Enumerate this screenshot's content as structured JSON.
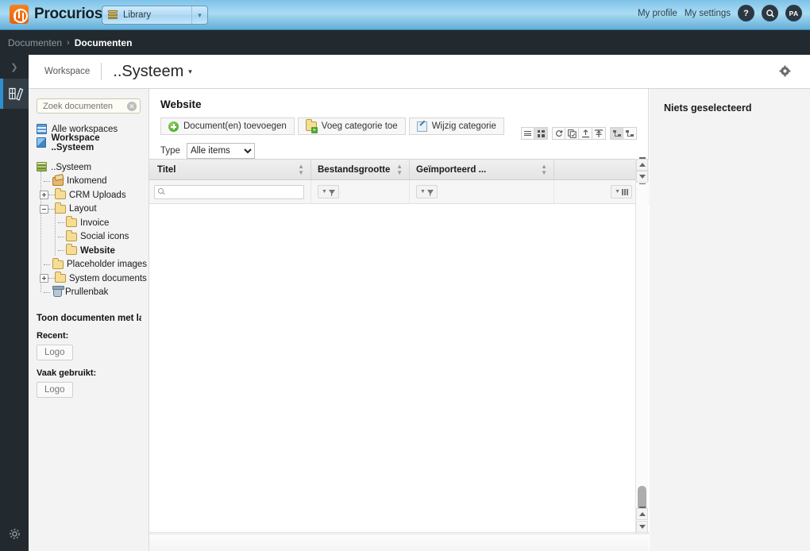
{
  "topbar": {
    "brand": "Procurios",
    "brand_color": "#f58220",
    "library_selector": {
      "label": "Library",
      "icon": "books-stack-icon"
    },
    "nav": [
      {
        "label": "My profile",
        "name": "my-profile-link"
      },
      {
        "label": "My settings",
        "name": "my-settings-link"
      }
    ],
    "help_button": "?",
    "search_button": "search-icon",
    "avatar_initials": "PA"
  },
  "breadcrumb": {
    "parent": "Documenten",
    "separator": "›",
    "current": "Documenten"
  },
  "rail": {
    "expand_icon": "chevron-right-icon",
    "active_item": "library-books-icon",
    "settings_icon": "gear-icon"
  },
  "workspace_header": {
    "tag": "Workspace",
    "title": "..Systeem",
    "caret": "▾",
    "settings_icon": "gear-icon"
  },
  "sidebar": {
    "search": {
      "value": "",
      "placeholder": "Zoek documenten",
      "clear_icon": "clear-circle-icon"
    },
    "workspaces": [
      {
        "label": "Alle workspaces",
        "icon": "all-workspaces-icon",
        "active": false
      },
      {
        "label": "Workspace ..Systeem",
        "icon": "workspace-icon",
        "active": true
      }
    ],
    "tree": [
      {
        "label": "..Systeem",
        "icon": "stack-icon",
        "level": 0,
        "toggle": "none",
        "bold": false
      },
      {
        "label": "Inkomend",
        "icon": "inbox-icon",
        "level": 1,
        "toggle": "none",
        "bold": false
      },
      {
        "label": "CRM Uploads",
        "icon": "folder-icon",
        "level": 1,
        "toggle": "plus",
        "bold": false
      },
      {
        "label": "Layout",
        "icon": "folder-icon",
        "level": 1,
        "toggle": "minus",
        "bold": false
      },
      {
        "label": "Invoice",
        "icon": "folder-icon",
        "level": 2,
        "toggle": "none",
        "bold": false
      },
      {
        "label": "Social icons",
        "icon": "folder-icon",
        "level": 2,
        "toggle": "none",
        "bold": false
      },
      {
        "label": "Website",
        "icon": "folder-icon",
        "level": 2,
        "toggle": "none",
        "bold": true
      },
      {
        "label": "Placeholder images",
        "icon": "folder-icon",
        "level": 1,
        "toggle": "none",
        "bold": false
      },
      {
        "label": "System documents",
        "icon": "folder-icon",
        "level": 1,
        "toggle": "plus",
        "bold": false
      },
      {
        "label": "Prullenbak",
        "icon": "trash-icon",
        "level": 1,
        "toggle": "none",
        "bold": false
      }
    ],
    "doc_filter": {
      "title": "Toon documenten met la",
      "recent_label": "Recent:",
      "recent_chip": "Logo",
      "frequent_label": "Vaak gebruikt:",
      "frequent_chip": "Logo"
    }
  },
  "main": {
    "title": "Website",
    "buttons": [
      {
        "label": "Document(en) toevoegen",
        "icon": "add-circle-icon",
        "name": "add-documents-button"
      },
      {
        "label": "Voeg categorie toe",
        "icon": "folder-add-icon",
        "name": "add-category-button"
      },
      {
        "label": "Wijzig categorie",
        "icon": "edit-category-icon",
        "name": "edit-category-button"
      }
    ],
    "type_filter": {
      "label": "Type",
      "selected": "Alle items",
      "options": [
        "Alle items"
      ]
    },
    "view_buttons": [
      {
        "icon": "list-view-icon",
        "active": false,
        "name": "list-view-button"
      },
      {
        "icon": "grid-view-icon",
        "active": true,
        "name": "grid-view-button"
      },
      {
        "icon": "refresh-icon",
        "active": false,
        "name": "refresh-button"
      },
      {
        "icon": "copy-icon",
        "active": false,
        "name": "copy-button"
      },
      {
        "icon": "upload-icon",
        "active": false,
        "name": "upload-button"
      },
      {
        "icon": "fit-width-icon",
        "active": false,
        "name": "fit-width-button"
      },
      {
        "icon": "tree-panel-left-icon",
        "active": true,
        "name": "tree-left-button"
      },
      {
        "icon": "tree-panel-right-icon",
        "active": false,
        "name": "tree-right-button"
      }
    ],
    "table": {
      "columns": [
        {
          "label": "Titel",
          "sortable": true,
          "name": "column-titel"
        },
        {
          "label": "Bestandsgrootte",
          "sortable": true,
          "name": "column-bestandsgrootte"
        },
        {
          "label": "Geïmporteerd ...",
          "sortable": true,
          "name": "column-geimporteerd"
        },
        {
          "label": "",
          "sortable": false,
          "name": "column-spacer"
        }
      ],
      "filter_row": {
        "titel_search_value": "",
        "titel_search_icon": "search-icon",
        "size_filter_icon": "filter-icon",
        "date_filter_icon": "filter-icon",
        "column-chooser_icon": "column-chooser-icon"
      },
      "rows": []
    },
    "scrollbar": {
      "top_button_icon": "scroll-top-icon",
      "second_button_icon": "scroll-page-up-icon",
      "bottom_up_icon": "scroll-up-icon",
      "bottom_down_icon": "scroll-down-icon"
    }
  },
  "right_panel": {
    "title": "Niets geselecteerd"
  }
}
